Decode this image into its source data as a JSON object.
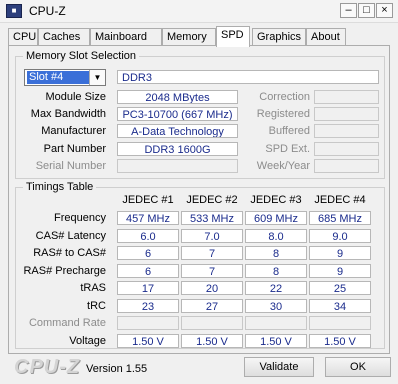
{
  "window": {
    "title": "CPU-Z",
    "icon_text": "CPU-Z",
    "minimize": "–",
    "maximize": "□",
    "close": "×"
  },
  "tabs": [
    "CPU",
    "Caches",
    "Mainboard",
    "Memory",
    "SPD",
    "Graphics",
    "About"
  ],
  "active_tab": "SPD",
  "memory_slot": {
    "group_title": "Memory Slot Selection",
    "slot_selected": "Slot #4",
    "type": "DDR3",
    "module_size_label": "Module Size",
    "module_size": "2048 MBytes",
    "max_bandwidth_label": "Max Bandwidth",
    "max_bandwidth": "PC3-10700 (667 MHz)",
    "manufacturer_label": "Manufacturer",
    "manufacturer": "A-Data Technology",
    "part_number_label": "Part Number",
    "part_number": "DDR3 1600G",
    "serial_number_label": "Serial Number",
    "serial_number": "",
    "correction_label": "Correction",
    "registered_label": "Registered",
    "buffered_label": "Buffered",
    "spd_ext_label": "SPD Ext.",
    "week_year_label": "Week/Year"
  },
  "timings": {
    "group_title": "Timings Table",
    "columns": [
      "JEDEC #1",
      "JEDEC #2",
      "JEDEC #3",
      "JEDEC #4"
    ],
    "rows": [
      {
        "label": "Frequency",
        "values": [
          "457 MHz",
          "533 MHz",
          "609 MHz",
          "685 MHz"
        ]
      },
      {
        "label": "CAS# Latency",
        "values": [
          "6.0",
          "7.0",
          "8.0",
          "9.0"
        ]
      },
      {
        "label": "RAS# to CAS#",
        "values": [
          "6",
          "7",
          "8",
          "9"
        ]
      },
      {
        "label": "RAS# Precharge",
        "values": [
          "6",
          "7",
          "8",
          "9"
        ]
      },
      {
        "label": "tRAS",
        "values": [
          "17",
          "20",
          "22",
          "25"
        ]
      },
      {
        "label": "tRC",
        "values": [
          "23",
          "27",
          "30",
          "34"
        ]
      },
      {
        "label": "Command Rate",
        "values": [
          "",
          "",
          "",
          ""
        ],
        "dim": true
      },
      {
        "label": "Voltage",
        "values": [
          "1.50 V",
          "1.50 V",
          "1.50 V",
          "1.50 V"
        ]
      }
    ]
  },
  "footer": {
    "logo": "CPU-Z",
    "version": "Version 1.55",
    "validate_label": "Validate",
    "ok_label": "OK"
  }
}
